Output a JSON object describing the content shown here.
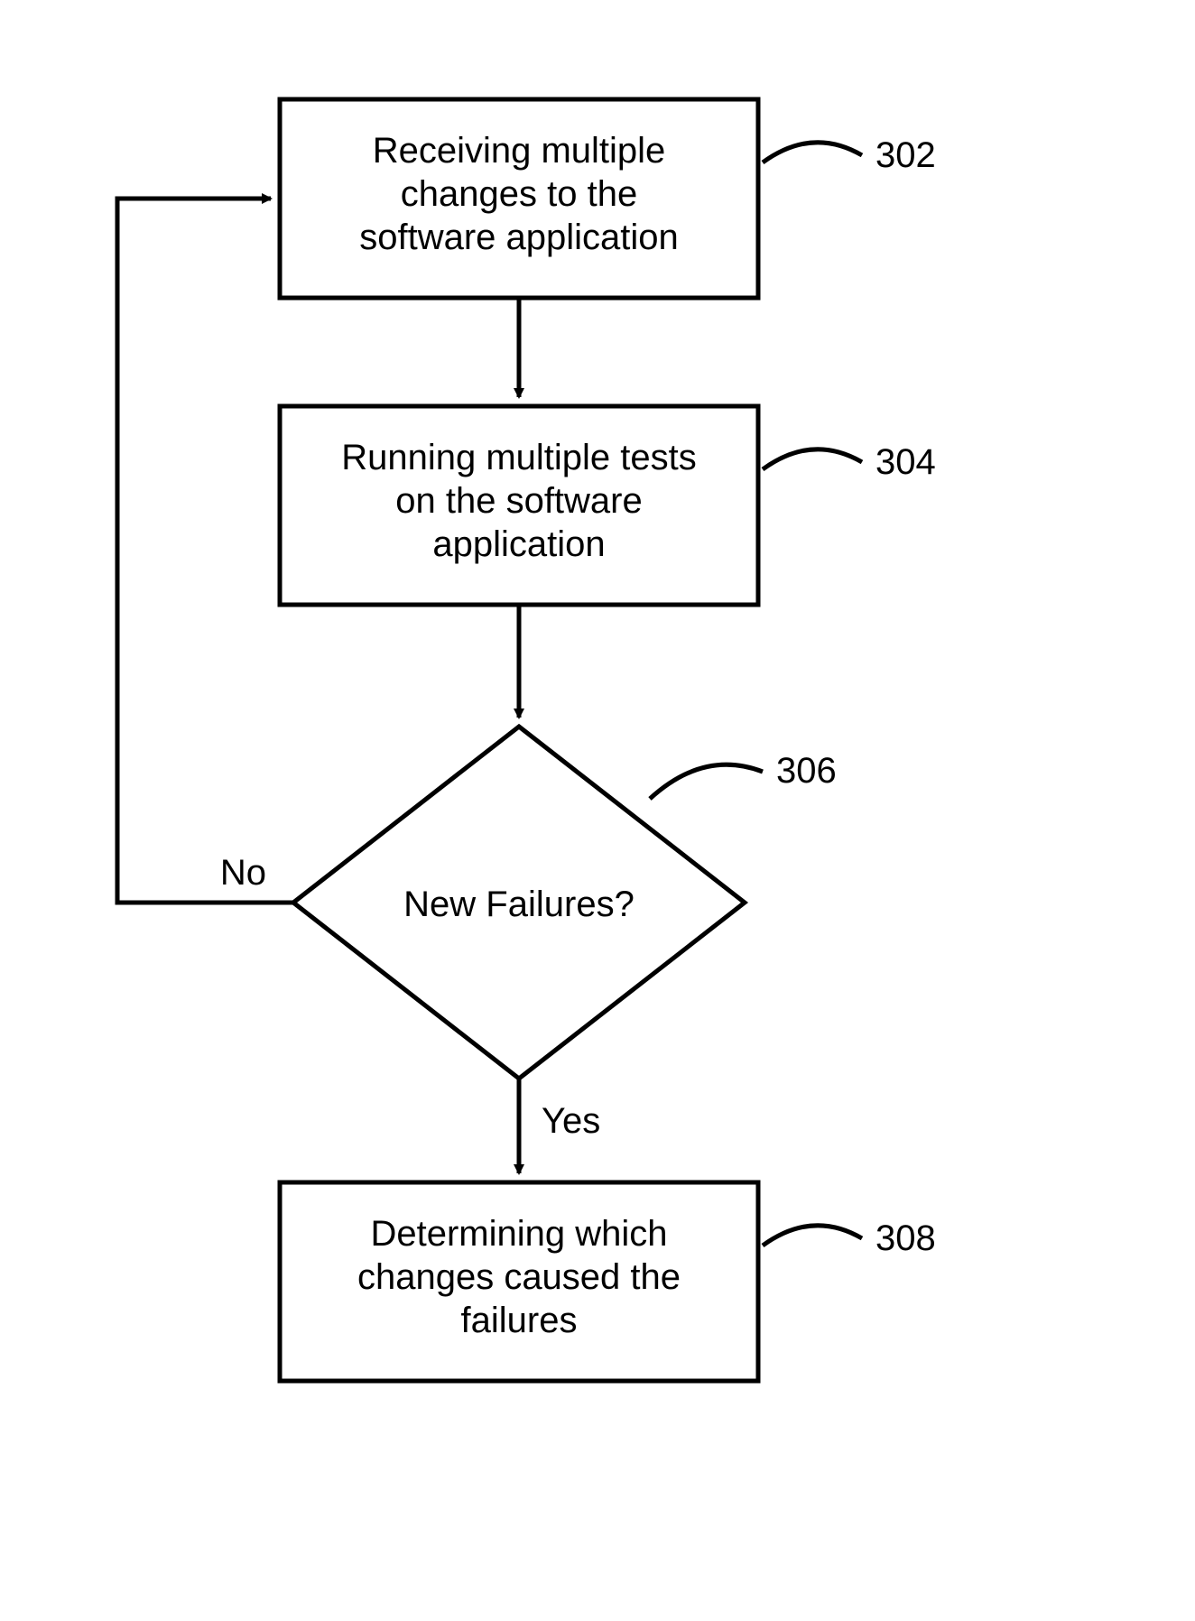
{
  "flowchart": {
    "box1": {
      "line1": "Receiving multiple",
      "line2": "changes to the",
      "line3": "software application",
      "ref": "302"
    },
    "box2": {
      "line1": "Running multiple tests",
      "line2": "on the software",
      "line3": "application",
      "ref": "304"
    },
    "decision": {
      "text": "New Failures?",
      "ref": "306",
      "branch_no": "No",
      "branch_yes": "Yes"
    },
    "box3": {
      "line1": "Determining which",
      "line2": "changes caused the",
      "line3": "failures",
      "ref": "308"
    }
  }
}
